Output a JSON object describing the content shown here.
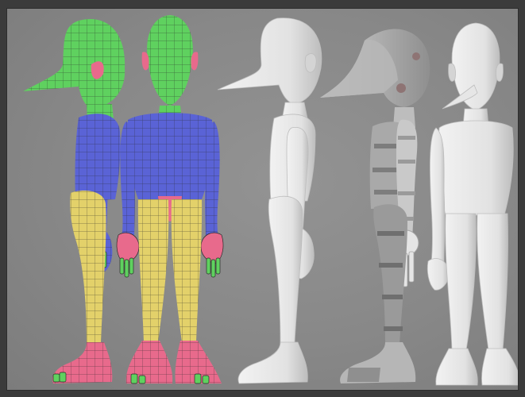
{
  "image": {
    "title": "",
    "palette": {
      "background": "#8a8a8a",
      "outer": "#3b3b3b",
      "head": "#5fd15f",
      "torso": "#5a63d6",
      "legs": "#e3d16a",
      "feet": "#e86a8c",
      "hands": "#5a63d6",
      "sculpt": "#e7e7e7",
      "sculpt_shadow": "#c7c7c7",
      "wire": "#2a2a2a"
    },
    "figures": [
      {
        "name": "polygroup-side",
        "style": "colored-wireframe"
      },
      {
        "name": "polygroup-front",
        "style": "colored-wireframe"
      },
      {
        "name": "sculpt-side",
        "style": "smooth-gray"
      },
      {
        "name": "uv-side",
        "style": "textured-gray"
      },
      {
        "name": "sculpt-front",
        "style": "smooth-gray"
      }
    ]
  }
}
